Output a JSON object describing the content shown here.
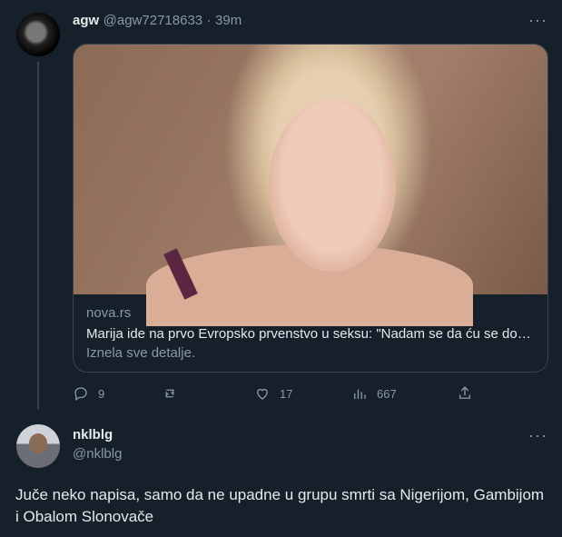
{
  "tweet": {
    "author_name": "agw",
    "author_handle": "@agw72718633",
    "separator": "·",
    "time": "39m",
    "more_icon": "more-horizontal-icon",
    "card": {
      "domain": "nova.rs",
      "title": "Marija ide na prvo Evropsko prvenstvo u seksu: \"Nadam se da ću se dokazati...",
      "description": "Iznela sve detalje."
    },
    "actions": {
      "reply_count": "9",
      "retweet_count": "",
      "like_count": "17",
      "views_count": "667"
    }
  },
  "reply": {
    "author_name": "nklblg",
    "author_handle": "@nklblg",
    "text": "Juče neko napisa, samo da ne upadne u grupu smrti sa Nigerijom, Gambijom i Obalom Slonovače"
  }
}
